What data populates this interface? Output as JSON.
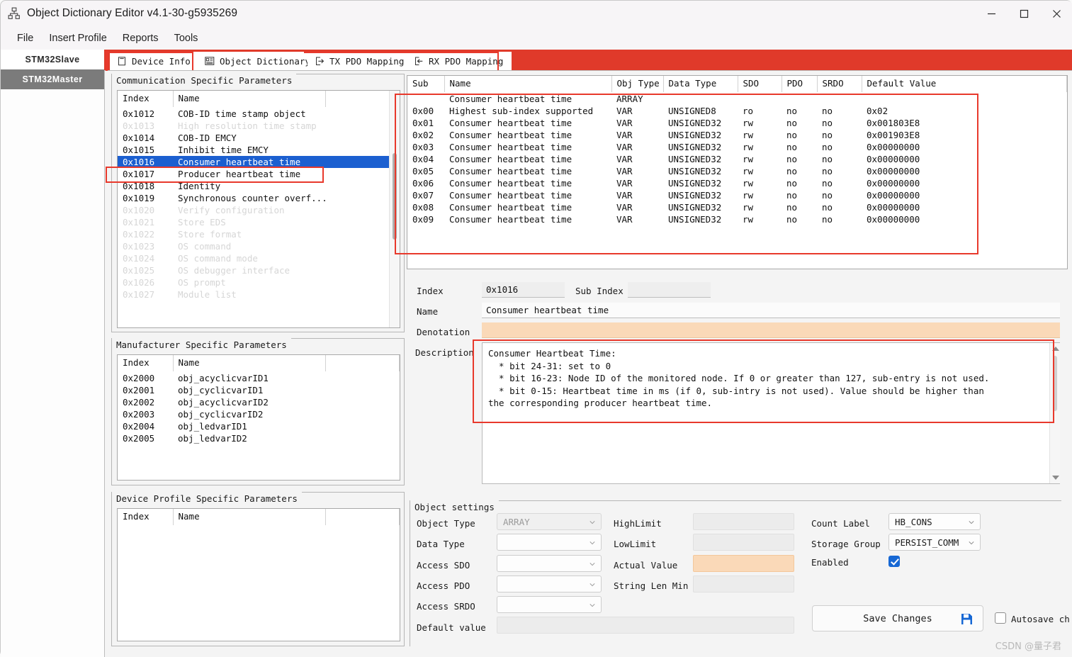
{
  "window": {
    "title": "Object Dictionary Editor v4.1-30-g5935269",
    "app_icon": "hierarchy-icon",
    "minimize": "minimize-icon",
    "maximize": "maximize-icon",
    "close": "close-icon"
  },
  "menubar": {
    "items": [
      {
        "label": "File"
      },
      {
        "label": "Insert Profile"
      },
      {
        "label": "Reports"
      },
      {
        "label": "Tools"
      }
    ]
  },
  "profile_tabs": [
    {
      "label": "STM32Slave",
      "active": true
    },
    {
      "label": "STM32Master",
      "active": false
    }
  ],
  "main_tabs": [
    {
      "label": "Device Info",
      "icon": "document-icon",
      "active": true
    },
    {
      "label": "Object Dictionary",
      "icon": "list-detail-icon",
      "active": false
    },
    {
      "label": "TX PDO Mapping",
      "icon": "arrow-out-box-icon",
      "active": false
    },
    {
      "label": "RX PDO Mapping",
      "icon": "arrow-in-box-icon",
      "active": false
    }
  ],
  "comm_params": {
    "title": "Communication Specific Parameters",
    "columns": [
      "Index",
      "Name"
    ],
    "rows": [
      {
        "index": "0x1012",
        "name": "COB-ID time stamp object",
        "state": "normal"
      },
      {
        "index": "0x1013",
        "name": "High resolution time stamp",
        "state": "disabled"
      },
      {
        "index": "0x1014",
        "name": "COB-ID EMCY",
        "state": "normal"
      },
      {
        "index": "0x1015",
        "name": "Inhibit time EMCY",
        "state": "normal"
      },
      {
        "index": "0x1016",
        "name": "Consumer heartbeat time",
        "state": "selected"
      },
      {
        "index": "0x1017",
        "name": "Producer heartbeat time",
        "state": "normal"
      },
      {
        "index": "0x1018",
        "name": "Identity",
        "state": "normal"
      },
      {
        "index": "0x1019",
        "name": "Synchronous counter overf...",
        "state": "normal"
      },
      {
        "index": "0x1020",
        "name": "Verify configuration",
        "state": "disabled"
      },
      {
        "index": "0x1021",
        "name": "Store EDS",
        "state": "disabled"
      },
      {
        "index": "0x1022",
        "name": "Store format",
        "state": "disabled"
      },
      {
        "index": "0x1023",
        "name": "OS command",
        "state": "disabled"
      },
      {
        "index": "0x1024",
        "name": "OS command mode",
        "state": "disabled"
      },
      {
        "index": "0x1025",
        "name": "OS debugger interface",
        "state": "disabled"
      },
      {
        "index": "0x1026",
        "name": "OS prompt",
        "state": "disabled"
      },
      {
        "index": "0x1027",
        "name": "Module list",
        "state": "disabled"
      }
    ]
  },
  "manufacturer_params": {
    "title": "Manufacturer Specific Parameters",
    "columns": [
      "Index",
      "Name"
    ],
    "rows": [
      {
        "index": "0x2000",
        "name": "obj_acyclicvarID1"
      },
      {
        "index": "0x2001",
        "name": "obj_cyclicvarID1"
      },
      {
        "index": "0x2002",
        "name": "obj_acyclicvarID2"
      },
      {
        "index": "0x2003",
        "name": "obj_cyclicvarID2"
      },
      {
        "index": "0x2004",
        "name": "obj_ledvarID1"
      },
      {
        "index": "0x2005",
        "name": "obj_ledvarID2"
      }
    ]
  },
  "device_profile_params": {
    "title": "Device Profile Specific Parameters",
    "columns": [
      "Index",
      "Name"
    ],
    "rows": []
  },
  "subindex_table": {
    "columns": [
      "Sub",
      "Name",
      "Obj Type",
      "Data Type",
      "SDO",
      "PDO",
      "SRDO",
      "Default Value"
    ],
    "rows": [
      {
        "sub": "",
        "name": "Consumer heartbeat time",
        "obj_type": "ARRAY",
        "data_type": "",
        "sdo": "",
        "pdo": "",
        "srdo": "",
        "default": ""
      },
      {
        "sub": "0x00",
        "name": "Highest sub-index supported",
        "obj_type": "VAR",
        "data_type": "UNSIGNED8",
        "sdo": "ro",
        "pdo": "no",
        "srdo": "no",
        "default": "0x02"
      },
      {
        "sub": "0x01",
        "name": "Consumer heartbeat time",
        "obj_type": "VAR",
        "data_type": "UNSIGNED32",
        "sdo": "rw",
        "pdo": "no",
        "srdo": "no",
        "default": "0x001803E8"
      },
      {
        "sub": "0x02",
        "name": "Consumer heartbeat time",
        "obj_type": "VAR",
        "data_type": "UNSIGNED32",
        "sdo": "rw",
        "pdo": "no",
        "srdo": "no",
        "default": "0x001903E8"
      },
      {
        "sub": "0x03",
        "name": "Consumer heartbeat time",
        "obj_type": "VAR",
        "data_type": "UNSIGNED32",
        "sdo": "rw",
        "pdo": "no",
        "srdo": "no",
        "default": "0x00000000"
      },
      {
        "sub": "0x04",
        "name": "Consumer heartbeat time",
        "obj_type": "VAR",
        "data_type": "UNSIGNED32",
        "sdo": "rw",
        "pdo": "no",
        "srdo": "no",
        "default": "0x00000000"
      },
      {
        "sub": "0x05",
        "name": "Consumer heartbeat time",
        "obj_type": "VAR",
        "data_type": "UNSIGNED32",
        "sdo": "rw",
        "pdo": "no",
        "srdo": "no",
        "default": "0x00000000"
      },
      {
        "sub": "0x06",
        "name": "Consumer heartbeat time",
        "obj_type": "VAR",
        "data_type": "UNSIGNED32",
        "sdo": "rw",
        "pdo": "no",
        "srdo": "no",
        "default": "0x00000000"
      },
      {
        "sub": "0x07",
        "name": "Consumer heartbeat time",
        "obj_type": "VAR",
        "data_type": "UNSIGNED32",
        "sdo": "rw",
        "pdo": "no",
        "srdo": "no",
        "default": "0x00000000"
      },
      {
        "sub": "0x08",
        "name": "Consumer heartbeat time",
        "obj_type": "VAR",
        "data_type": "UNSIGNED32",
        "sdo": "rw",
        "pdo": "no",
        "srdo": "no",
        "default": "0x00000000"
      },
      {
        "sub": "0x09",
        "name": "Consumer heartbeat time",
        "obj_type": "VAR",
        "data_type": "UNSIGNED32",
        "sdo": "rw",
        "pdo": "no",
        "srdo": "no",
        "default": "0x00000000"
      }
    ]
  },
  "detail": {
    "index_label": "Index",
    "index_value": "0x1016",
    "sub_index_label": "Sub Index",
    "sub_index_value": "",
    "name_label": "Name",
    "name_value": "Consumer heartbeat time",
    "denotation_label": "Denotation",
    "denotation_value": "",
    "description_label": "Description",
    "description_value": "Consumer Heartbeat Time:\n  * bit 24-31: set to 0\n  * bit 16-23: Node ID of the monitored node. If 0 or greater than 127, sub-entry is not used.\n  * bit 0-15: Heartbeat time in ms (if 0, sub-intry is not used). Value should be higher than\nthe corresponding producer heartbeat time."
  },
  "object_settings": {
    "title": "Object settings",
    "left": [
      {
        "label": "Object Type",
        "value": "ARRAY",
        "kind": "combo"
      },
      {
        "label": "Data Type",
        "value": "",
        "kind": "combo"
      },
      {
        "label": "Access SDO",
        "value": "",
        "kind": "combo"
      },
      {
        "label": "Access PDO",
        "value": "",
        "kind": "combo"
      },
      {
        "label": "Access SRDO",
        "value": "",
        "kind": "combo"
      },
      {
        "label": "Default value",
        "value": "",
        "kind": "field"
      }
    ],
    "middle": [
      {
        "label": "HighLimit",
        "value": "",
        "kind": "field"
      },
      {
        "label": "LowLimit",
        "value": "",
        "kind": "field"
      },
      {
        "label": "Actual Value",
        "value": "",
        "kind": "field-peach"
      },
      {
        "label": "String Len Min",
        "value": "",
        "kind": "field"
      }
    ],
    "right": [
      {
        "label": "Count Label",
        "value": "HB_CONS",
        "kind": "combo"
      },
      {
        "label": "Storage Group",
        "value": "PERSIST_COMM",
        "kind": "combo"
      }
    ],
    "enabled_label": "Enabled",
    "enabled_checked": true,
    "save_button": "Save Changes",
    "save_icon": "floppy-disk-icon",
    "autosave_label": "Autosave ch",
    "autosave_checked": false
  },
  "watermark": "CSDN @量子君",
  "colors": {
    "accent_red": "#e8392c",
    "selection_blue": "#1b5fd0",
    "peach": "#fad9b8",
    "checkbox_blue": "#1768d4"
  }
}
